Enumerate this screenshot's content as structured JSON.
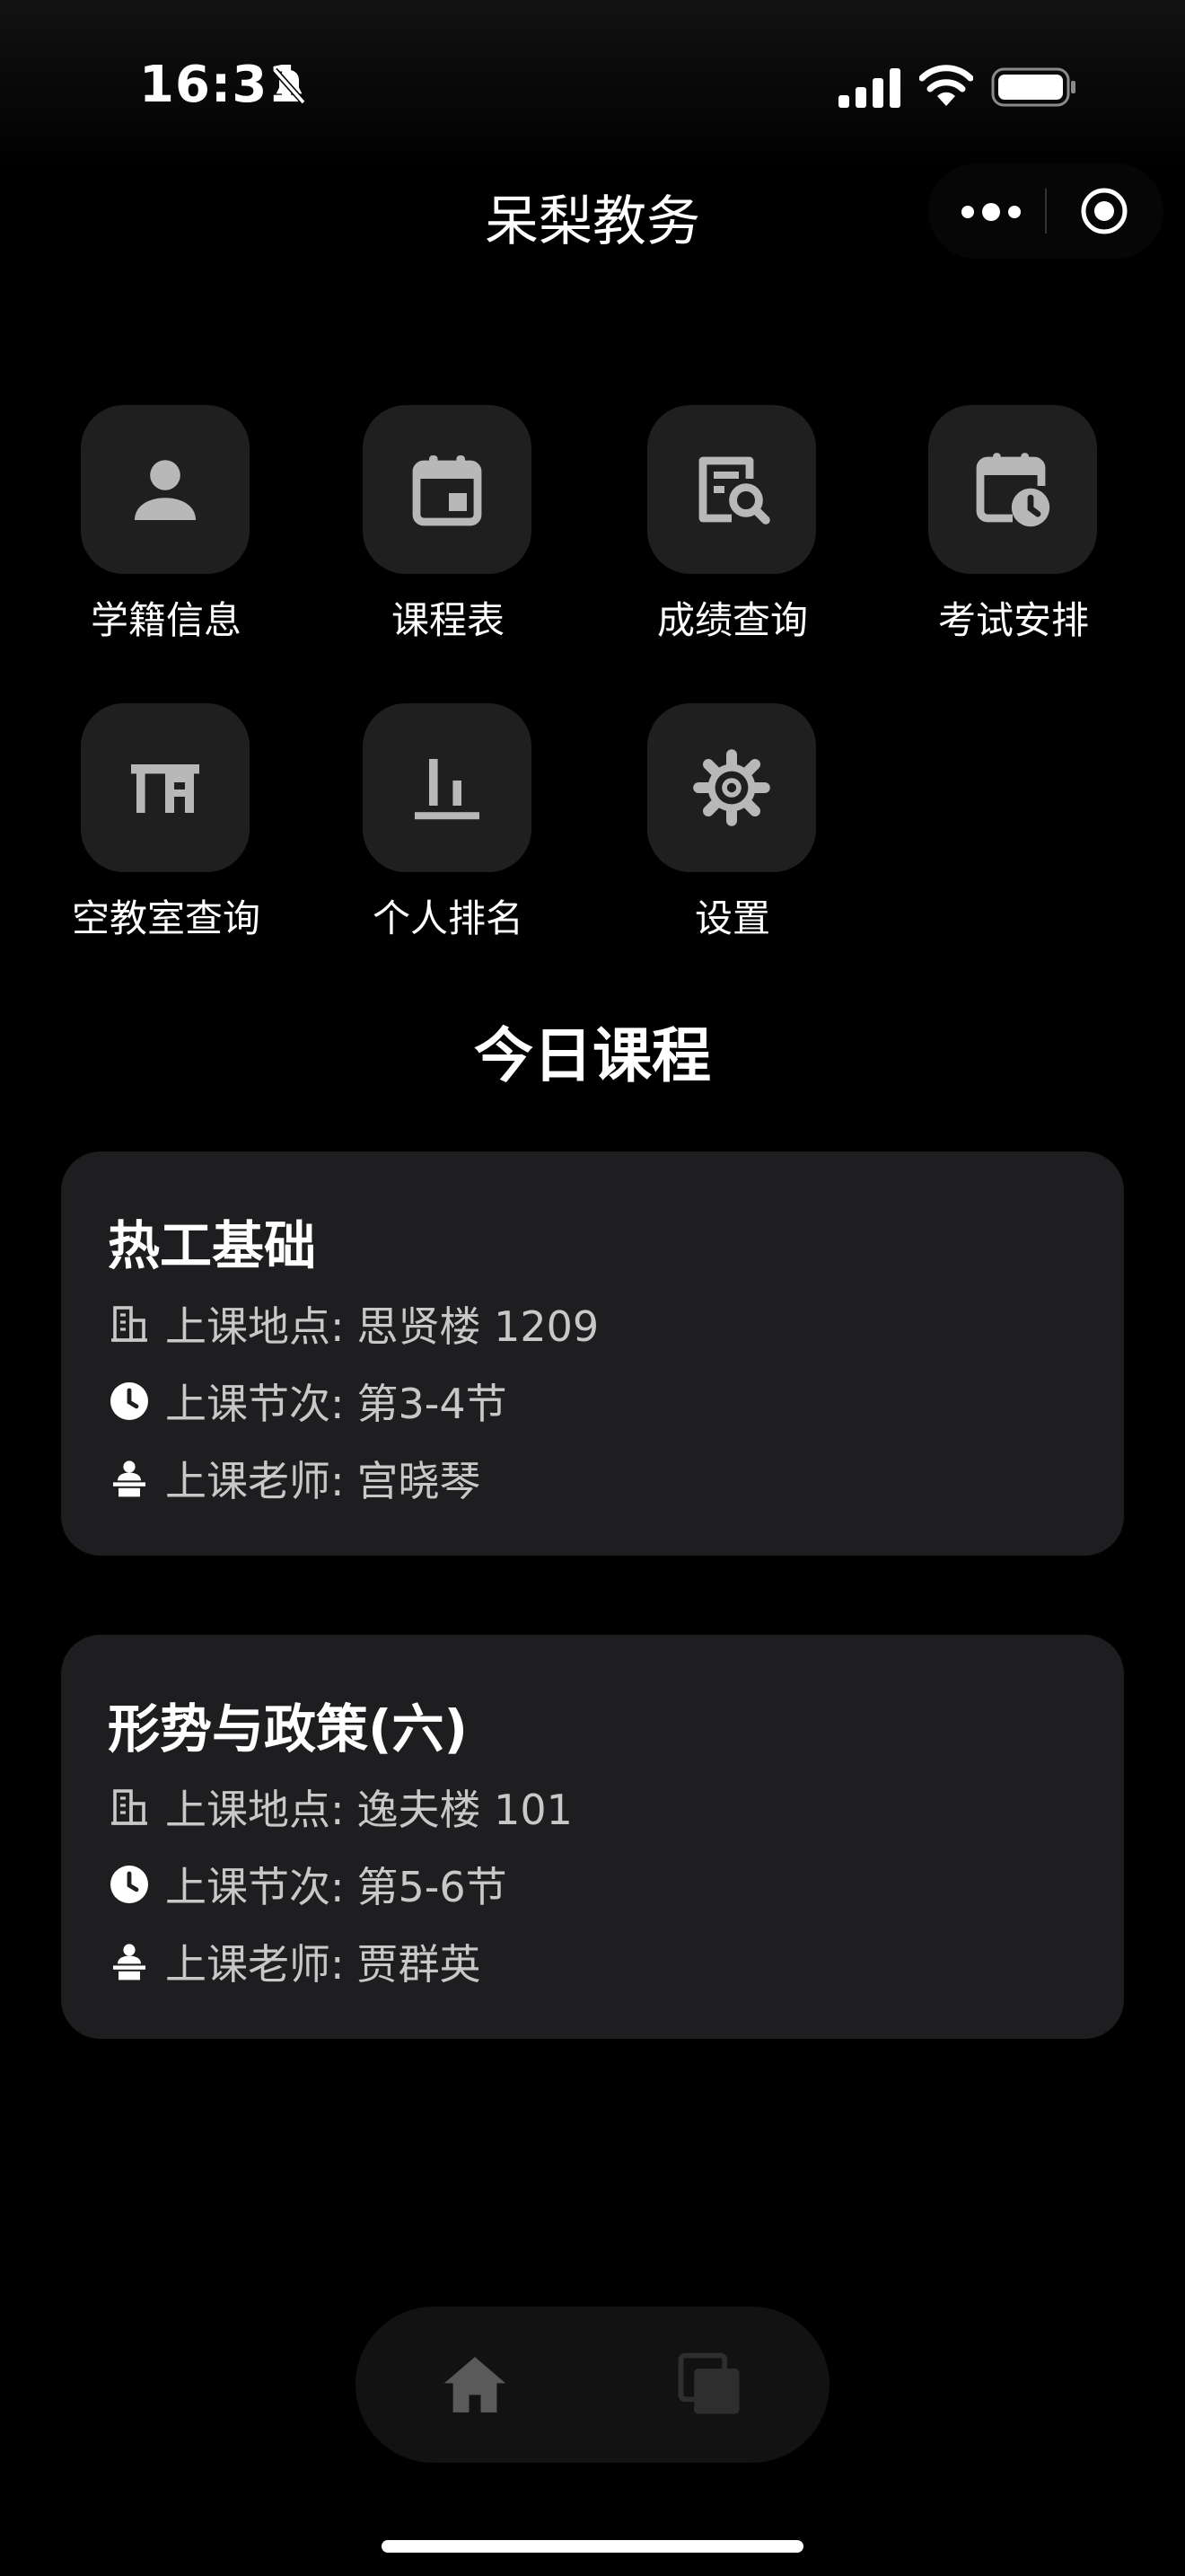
{
  "status_bar": {
    "time": "16:31",
    "icons": [
      "bell-muted-icon",
      "signal-icon",
      "wifi-icon",
      "battery-icon"
    ]
  },
  "navbar": {
    "title": "呆梨教务",
    "capsule_icons": [
      "more-icon",
      "target-icon"
    ]
  },
  "menu": [
    {
      "label": "学籍信息",
      "icon": "person-icon"
    },
    {
      "label": "课程表",
      "icon": "calendar-icon"
    },
    {
      "label": "成绩查询",
      "icon": "report-search-icon"
    },
    {
      "label": "考试安排",
      "icon": "calendar-clock-icon"
    },
    {
      "label": "空教室查询",
      "icon": "classroom-desk-icon"
    },
    {
      "label": "个人排名",
      "icon": "ranking-bars-icon"
    },
    {
      "label": "设置",
      "icon": "gear-icon"
    }
  ],
  "today": {
    "title": "今日课程",
    "courses": [
      {
        "name": "热工基础",
        "location_label": "上课地点:",
        "location": "思贤楼 1209",
        "period_label": "上课节次:",
        "period": "第3-4节",
        "teacher_label": "上课老师:",
        "teacher": "宫晓琴"
      },
      {
        "name": "形势与政策(六)",
        "location_label": "上课地点:",
        "location": "逸夫楼 101",
        "period_label": "上课节次:",
        "period": "第5-6节",
        "teacher_label": "上课老师:",
        "teacher": "贾群英"
      }
    ]
  },
  "tabbar": {
    "items": [
      "home-icon",
      "pages-icon"
    ]
  },
  "colors": {
    "background": "#000000",
    "tile": "#1f1f1f",
    "card": "#1e1e20",
    "icon": "#b8b8b8",
    "secondary_text": "#c8c8c8"
  }
}
